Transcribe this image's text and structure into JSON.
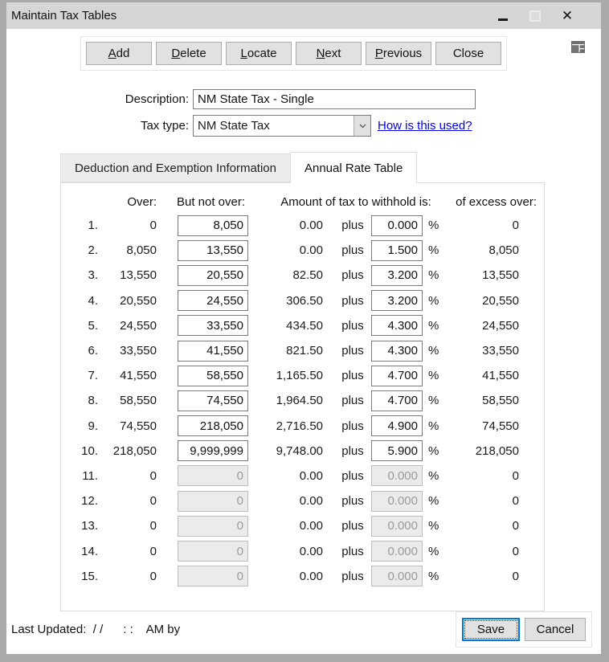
{
  "window": {
    "title": "Maintain Tax Tables"
  },
  "toolbar": {
    "buttons": [
      {
        "label": "Add",
        "access_key": "A"
      },
      {
        "label": "Delete",
        "access_key": "D"
      },
      {
        "label": "Locate",
        "access_key": "L"
      },
      {
        "label": "Next",
        "access_key": "N"
      },
      {
        "label": "Previous",
        "access_key": "P"
      },
      {
        "label": "Close",
        "access_key": null
      }
    ]
  },
  "form": {
    "description_label": "Description:",
    "description_value": "NM State Tax - Single",
    "tax_type_label": "Tax type:",
    "tax_type_value": "NM State Tax",
    "help_link": "How is this used?"
  },
  "tabs": [
    {
      "label": "Deduction and Exemption Information",
      "active": false
    },
    {
      "label": "Annual Rate Table",
      "active": true
    }
  ],
  "rate_table": {
    "headers": {
      "over": "Over:",
      "but_not_over": "But not over:",
      "amount": "Amount of tax to withhold is:",
      "excess": "of excess over:"
    },
    "plus_label": "plus",
    "percent_label": "%",
    "rows": [
      {
        "num": "1.",
        "over": "0",
        "but_not_over": "8,050",
        "amount": "0.00",
        "rate": "0.000",
        "excess": "0",
        "enabled": true
      },
      {
        "num": "2.",
        "over": "8,050",
        "but_not_over": "13,550",
        "amount": "0.00",
        "rate": "1.500",
        "excess": "8,050",
        "enabled": true
      },
      {
        "num": "3.",
        "over": "13,550",
        "but_not_over": "20,550",
        "amount": "82.50",
        "rate": "3.200",
        "excess": "13,550",
        "enabled": true
      },
      {
        "num": "4.",
        "over": "20,550",
        "but_not_over": "24,550",
        "amount": "306.50",
        "rate": "3.200",
        "excess": "20,550",
        "enabled": true
      },
      {
        "num": "5.",
        "over": "24,550",
        "but_not_over": "33,550",
        "amount": "434.50",
        "rate": "4.300",
        "excess": "24,550",
        "enabled": true
      },
      {
        "num": "6.",
        "over": "33,550",
        "but_not_over": "41,550",
        "amount": "821.50",
        "rate": "4.300",
        "excess": "33,550",
        "enabled": true
      },
      {
        "num": "7.",
        "over": "41,550",
        "but_not_over": "58,550",
        "amount": "1,165.50",
        "rate": "4.700",
        "excess": "41,550",
        "enabled": true
      },
      {
        "num": "8.",
        "over": "58,550",
        "but_not_over": "74,550",
        "amount": "1,964.50",
        "rate": "4.700",
        "excess": "58,550",
        "enabled": true
      },
      {
        "num": "9.",
        "over": "74,550",
        "but_not_over": "218,050",
        "amount": "2,716.50",
        "rate": "4.900",
        "excess": "74,550",
        "enabled": true
      },
      {
        "num": "10.",
        "over": "218,050",
        "but_not_over": "9,999,999",
        "amount": "9,748.00",
        "rate": "5.900",
        "excess": "218,050",
        "enabled": true
      },
      {
        "num": "11.",
        "over": "0",
        "but_not_over": "0",
        "amount": "0.00",
        "rate": "0.000",
        "excess": "0",
        "enabled": false
      },
      {
        "num": "12.",
        "over": "0",
        "but_not_over": "0",
        "amount": "0.00",
        "rate": "0.000",
        "excess": "0",
        "enabled": false
      },
      {
        "num": "13.",
        "over": "0",
        "but_not_over": "0",
        "amount": "0.00",
        "rate": "0.000",
        "excess": "0",
        "enabled": false
      },
      {
        "num": "14.",
        "over": "0",
        "but_not_over": "0",
        "amount": "0.00",
        "rate": "0.000",
        "excess": "0",
        "enabled": false
      },
      {
        "num": "15.",
        "over": "0",
        "but_not_over": "0",
        "amount": "0.00",
        "rate": "0.000",
        "excess": "0",
        "enabled": false
      }
    ]
  },
  "footer": {
    "last_updated": "Last Updated:  / /      : :    AM by",
    "save_label": "Save",
    "cancel_label": "Cancel"
  },
  "colors": {
    "accent_focus_border": "#0078d7",
    "link": "#0000ee",
    "titlebar": "#d6d6d6",
    "button_face": "#e1e1e1",
    "disabled_field": "#ebebeb"
  }
}
